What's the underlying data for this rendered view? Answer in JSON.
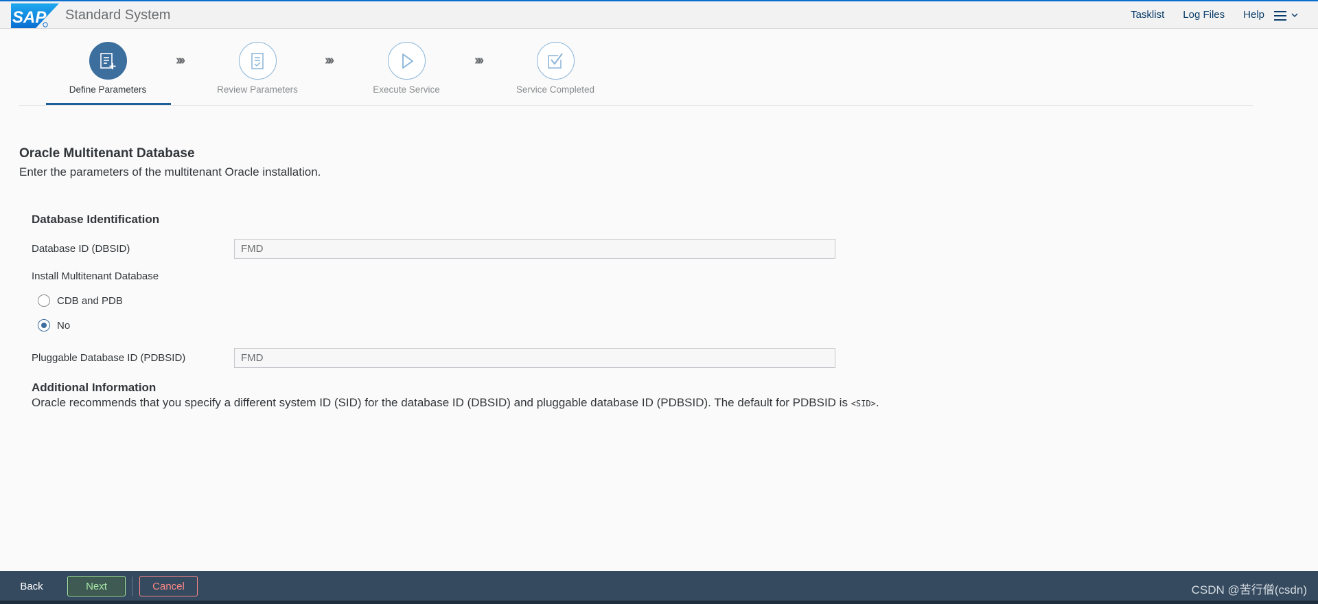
{
  "shell": {
    "logo_text": "SAP",
    "title": "Standard System",
    "links": {
      "tasklist": "Tasklist",
      "log_files": "Log Files",
      "help": "Help"
    },
    "menu_icon": "hamburger-menu-icon"
  },
  "wizard": {
    "steps": [
      {
        "label": "Define Parameters",
        "icon": "edit-list-icon",
        "state": "active"
      },
      {
        "label": "Review Parameters",
        "icon": "checklist-document-icon",
        "state": "inactive"
      },
      {
        "label": "Execute Service",
        "icon": "play-icon",
        "state": "inactive"
      },
      {
        "label": "Service Completed",
        "icon": "checkbox-icon",
        "state": "inactive"
      }
    ],
    "separator": "»»"
  },
  "page": {
    "heading": "Oracle Multitenant Database",
    "description": "Enter the parameters of the multitenant Oracle installation."
  },
  "form": {
    "section_title": "Database Identification",
    "dbsid": {
      "label": "Database ID (DBSID)",
      "value": "FMD"
    },
    "multitenant": {
      "label": "Install Multitenant Database",
      "options": [
        {
          "label": "CDB and PDB",
          "checked": false
        },
        {
          "label": "No",
          "checked": true
        }
      ]
    },
    "pdbsid": {
      "label": "Pluggable Database ID (PDBSID)",
      "value": "FMD"
    }
  },
  "info": {
    "title": "Additional Information",
    "text": "Oracle recommends that you specify a different system ID (SID) for the database ID (DBSID) and pluggable database ID (PDBSID). The default for PDBSID is ",
    "code": "<SID>",
    "suffix": "."
  },
  "footer": {
    "back": "Back",
    "next": "Next",
    "cancel": "Cancel",
    "watermark": "CSDN @苦行僧(csdn)"
  },
  "colors": {
    "accent": "#3c6f9e",
    "footer_bg": "#354a5f",
    "next": "#a7e6a7",
    "cancel": "#ff8888"
  }
}
